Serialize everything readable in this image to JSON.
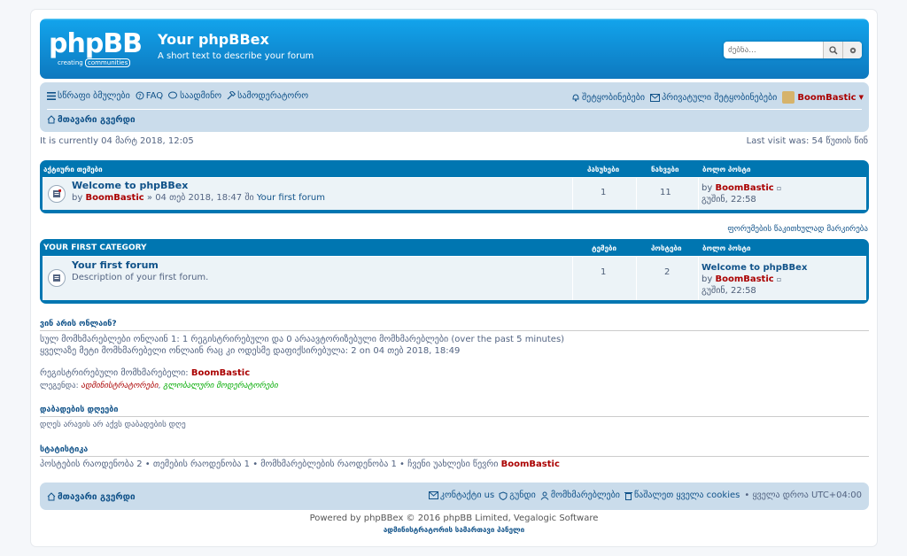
{
  "header": {
    "logo_text": "phpBB",
    "logo_sub1": "creating",
    "logo_sub2": "communities",
    "title": "Your phpBBex",
    "description": "A short text to describe your forum",
    "search_placeholder": "ძებნა..."
  },
  "nav": {
    "quick_links": "სწრაფი ბმულები",
    "faq": "FAQ",
    "chat": "საადმინო",
    "moderation": "სამოდერატორო",
    "notifications": "შეტყობინებები",
    "pm": "პრივატული შეტყობინებები",
    "username": "BoomBastic",
    "home": "მთავარი გვერდი"
  },
  "meta": {
    "current_time": "It is currently 04 მარტ 2018, 12:05",
    "last_visit": "Last visit was: 54 წუთის წინ"
  },
  "active_topics": {
    "header": "აქტიური თემები",
    "col_replies": "პასუხები",
    "col_views": "ნახვები",
    "col_last": "ბოლო პოსტი",
    "topic_title": "Welcome to phpBBex",
    "by_label": "by",
    "author": "BoomBastic",
    "date_info": "» 04 თებ 2018, 18:47 ში",
    "forum": "Your first forum",
    "replies": "1",
    "views": "11",
    "last_author": "BoomBastic",
    "last_time": "გუშინ, 22:58"
  },
  "mark_read": "ფორუმების წაკითხულად მარკირება",
  "category": {
    "name": "YOUR FIRST CATEGORY",
    "col_topics": "ტემები",
    "col_posts": "პოსტები",
    "col_last": "ბოლო პოსტი",
    "forum_title": "Your first forum",
    "forum_desc": "Description of your first forum.",
    "topics": "1",
    "posts": "2",
    "last_title": "Welcome to phpBBex",
    "last_author": "BoomBastic",
    "last_time": "გუშინ, 22:58"
  },
  "online": {
    "title": "ვინ არის ონლაინ?",
    "line1": "სულ მომხმარებლები ონლაინ 1: 1 რეგისტრირებული და 0 არაავტორიზებული მომხმარებლები (over the past 5 minutes)",
    "line2": "ყველაზე მეტი მომხმარებელი ონლაინ რაც კი ოდესმე დაფიქსირებულა: 2 on 04 თებ 2018, 18:49",
    "registered_label": "რეგისტრირებული მომხმარებელი:",
    "registered_user": "BoomBastic",
    "legend_label": "ლეგენდა:",
    "legend_admins": "ადმინისტრატორები",
    "legend_mods": "გლობალური მოდერატორები"
  },
  "birthdays": {
    "title": "დაბადების დღეები",
    "text": "დღეს არავის არ აქვს დაბადების დღე"
  },
  "stats": {
    "title": "სტატისტიკა",
    "text": "პოსტების რაოდენობა 2 • თემების რაოდენობა 1 • მომხმარებლების რაოდენობა 1 • ჩვენი უახლესი წევრი",
    "newest": "BoomBastic"
  },
  "footer": {
    "home": "მთავარი გვერდი",
    "contact": "კონტაქტი us",
    "team": "გუნდი",
    "members": "მომხმარებლები",
    "delete_cookies": "წაშალეთ ყველა cookies",
    "timezone": "ყველა დროა UTC+04:00",
    "powered": "Powered by phpBBex © 2016 phpBB Limited, Vegalogic Software",
    "acp": "ადმინისტრატორის სამართავი პანელი"
  }
}
